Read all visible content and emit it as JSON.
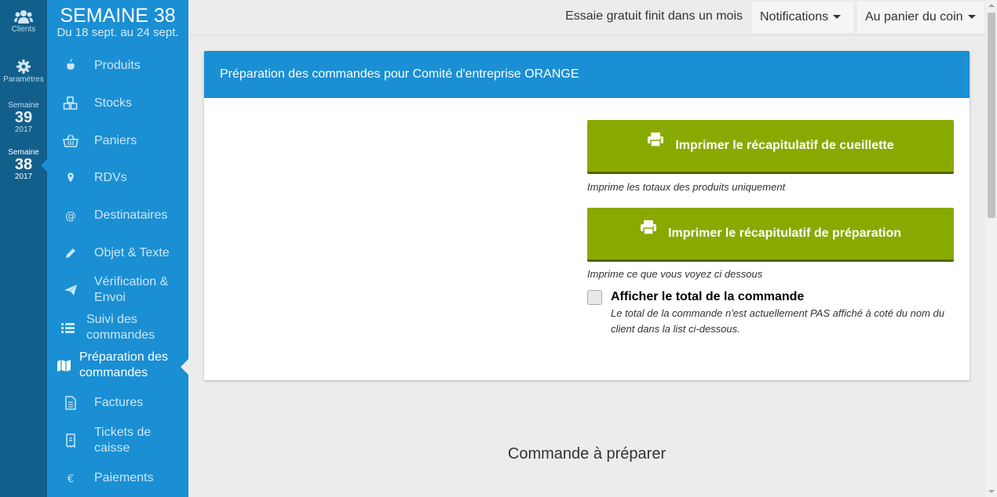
{
  "rail": {
    "clients_label": "Clients",
    "settings_label": "Paramètres",
    "weeks": [
      {
        "small": "Semaine",
        "number": "39",
        "year": "2017"
      },
      {
        "small": "Semaine",
        "number": "38",
        "year": "2017"
      }
    ]
  },
  "sidebar": {
    "week_title": "SEMAINE 38",
    "week_range": "Du 18 sept. au 24 sept.",
    "items": [
      {
        "label": "Produits",
        "icon": "apple-icon"
      },
      {
        "label": "Stocks",
        "icon": "cubes-icon"
      },
      {
        "label": "Paniers",
        "icon": "basket-icon"
      },
      {
        "label": "RDVs",
        "icon": "map-marker-icon"
      },
      {
        "label": "Destinataires",
        "icon": "at-icon"
      },
      {
        "label": "Objet & Texte",
        "icon": "pencil-icon"
      },
      {
        "label": "Vérification & Envoi",
        "icon": "paper-plane-icon"
      },
      {
        "label": "Suivi des commandes",
        "icon": "list-icon"
      },
      {
        "label": "Préparation des commandes",
        "icon": "map-icon"
      },
      {
        "label": "Factures",
        "icon": "file-icon"
      },
      {
        "label": "Tickets de caisse",
        "icon": "receipt-icon"
      },
      {
        "label": "Paiements",
        "icon": "euro-icon"
      }
    ]
  },
  "topbar": {
    "trial_text": "Essaie gratuit finit dans un mois",
    "notifications": "Notifications",
    "account": "Au panier du coin"
  },
  "panel": {
    "title": "Préparation des commandes pour Comité d'entreprise ORANGE",
    "btn_picking": "Imprimer le récapitulatif de cueillette",
    "hint_picking": "Imprime les totaux des produits uniquement",
    "btn_preparation": "Imprimer le récapitulatif de préparation",
    "hint_preparation": "Imprime ce que vous voyez ci dessous",
    "checkbox_label": "Afficher le total de la commande",
    "checkbox_desc": "Le total de la commande n'est actuellement PAS affiché à coté du nom du client dans la list ci-dessous."
  },
  "section_title": "Commande à préparer",
  "colors": {
    "accent": "#1a8fd3",
    "rail": "#135f8b",
    "button": "#8aa900"
  }
}
